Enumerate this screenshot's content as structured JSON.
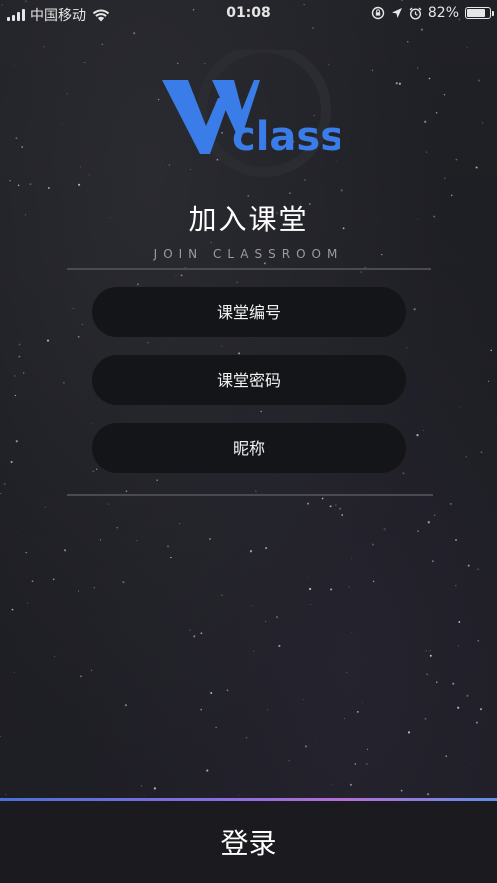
{
  "status_bar": {
    "carrier": "中国移动",
    "time": "01:08",
    "battery_percent": "82%",
    "battery_level": 0.82,
    "icons": [
      "signal-icon",
      "wifi-icon",
      "lock-rotation-icon",
      "location-icon",
      "alarm-icon",
      "battery-icon"
    ]
  },
  "logo": {
    "text": "class",
    "brand_color": "#3a7de8"
  },
  "header": {
    "title": "加入课堂",
    "subtitle": "JOIN CLASSROOM"
  },
  "form": {
    "room_number_placeholder": "课堂编号",
    "room_password_placeholder": "课堂密码",
    "nickname_placeholder": "昵称"
  },
  "footer": {
    "login_label": "登录"
  }
}
